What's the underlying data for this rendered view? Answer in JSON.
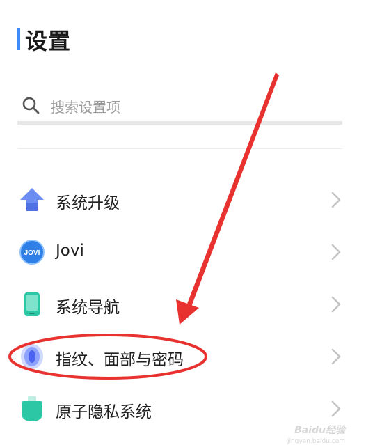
{
  "header": {
    "title": "设置"
  },
  "search": {
    "placeholder": "搜索设置项"
  },
  "settings": [
    {
      "label": "系统升级",
      "icon": "upgrade-arrow-icon"
    },
    {
      "label": "Jovi",
      "icon": "jovi-icon",
      "icon_text": "JOVI"
    },
    {
      "label": "系统导航",
      "icon": "phone-navigation-icon"
    },
    {
      "label": "指纹、面部与密码",
      "icon": "fingerprint-icon"
    },
    {
      "label": "原子隐私系统",
      "icon": "privacy-shield-icon"
    }
  ],
  "watermark": {
    "brand": "Baidu经验",
    "domain": "jingyan.baidu.com"
  },
  "colors": {
    "accent": "#3a8ef6",
    "annotation": "#e8322f"
  }
}
